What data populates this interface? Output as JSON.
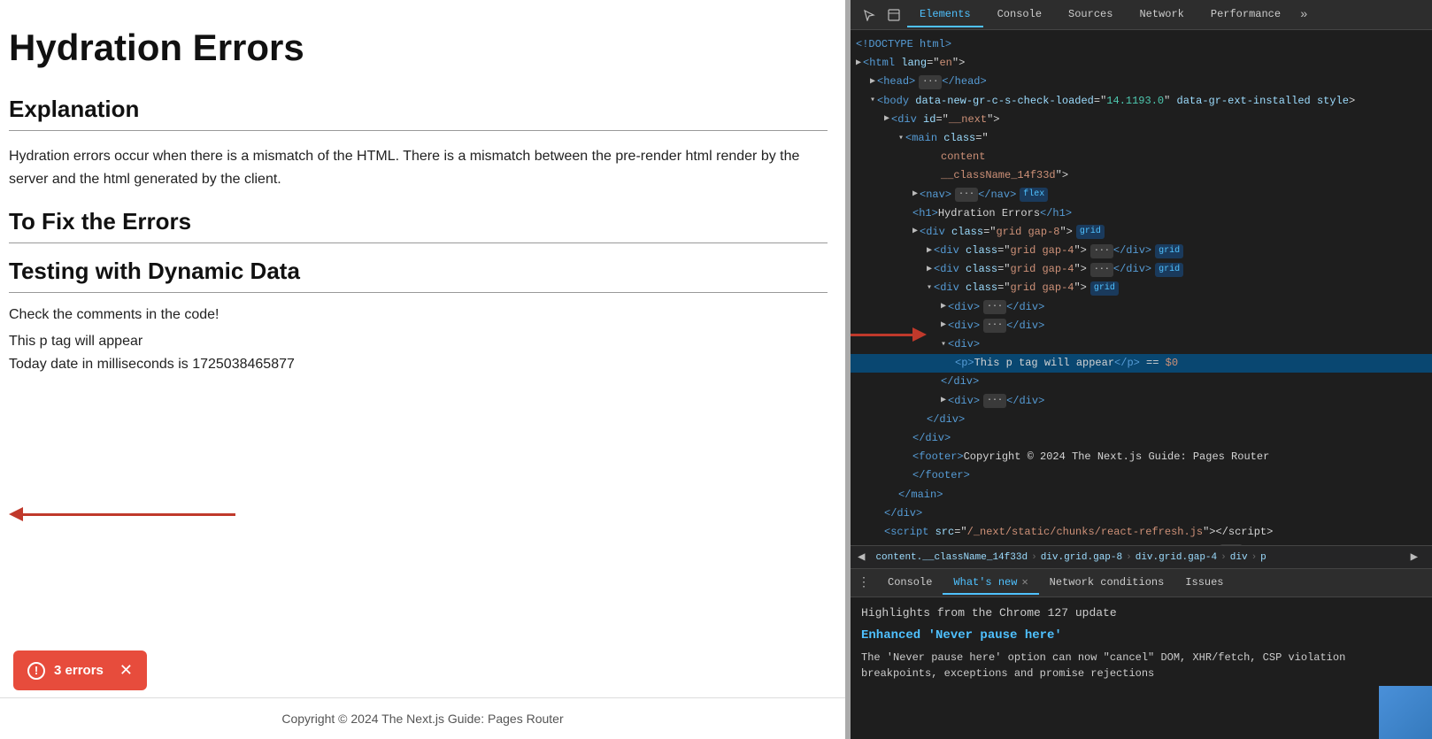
{
  "page": {
    "title": "Hydration Errors",
    "sections": [
      {
        "heading": "Explanation",
        "text": "Hydration errors occur when there is a mismatch of the HTML. There is a mismatch between the pre-render html render by the server and the html generated by the client."
      },
      {
        "heading": "To Fix the Errors",
        "text": ""
      },
      {
        "heading": "Testing with Dynamic Data",
        "text": ""
      }
    ],
    "check_comments": "Check the comments in the code!",
    "p_tag_text": "This p tag will appear",
    "date_line": "Today date in milliseconds is 1725038465877",
    "footer": "Copyright © 2024 The Next.js Guide: Pages Router",
    "error_count": "3 errors"
  },
  "devtools": {
    "tabs": [
      "Elements",
      "Console",
      "Sources",
      "Network",
      "Performance"
    ],
    "active_tab": "Elements",
    "more_label": "»",
    "breadcrumb": [
      "content.__className_14f33d",
      "div.grid.gap-8",
      "div.grid.gap-4",
      "div",
      "p"
    ],
    "bottom_tabs": [
      "Console",
      "What's new",
      "Network conditions",
      "Issues"
    ],
    "active_bottom_tab": "What's new",
    "highlights_title": "Highlights from the Chrome 127 update",
    "whats_new_title": "Enhanced 'Never pause here'",
    "whats_new_text": "The 'Never pause here' option can now \"cancel\" DOM, XHR/fetch, CSP violation breakpoints, exceptions and promise rejections"
  },
  "icons": {
    "cursor": "⊹",
    "inspect": "⬜",
    "close": "✕",
    "triangle_right": "▶",
    "triangle_down": "▾",
    "ellipsis": "···",
    "more_vert": "⋮",
    "error_exclaim": "!",
    "arrow_left": "←"
  }
}
